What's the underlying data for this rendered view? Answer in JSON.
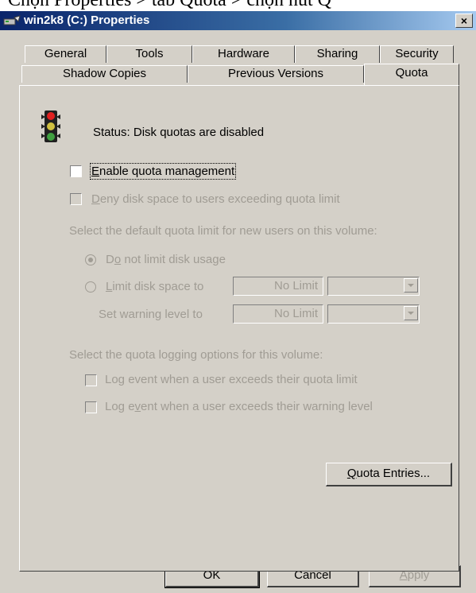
{
  "caption": "Chọn Properties > tab Quota > chọn nút Q",
  "window": {
    "title": "win2k8 (C:) Properties",
    "close_label": "×"
  },
  "tabs": {
    "row1": [
      "General",
      "Tools",
      "Hardware",
      "Sharing",
      "Security"
    ],
    "row2": [
      "Shadow Copies",
      "Previous Versions",
      "Quota"
    ],
    "active": "Quota"
  },
  "quota": {
    "status": "Status:  Disk quotas are disabled",
    "enable_quota": {
      "label_first": "E",
      "label_rest": "nable quota management",
      "checked": false
    },
    "deny_space": {
      "label_first": "D",
      "label_rest": "eny disk space to users exceeding quota limit",
      "checked": false
    },
    "default_limit_heading": "Select the default quota limit for new users on this volume:",
    "no_limit_radio": {
      "label_pre": "D",
      "label_u": "o",
      "label_rest": " not limit disk usage",
      "selected": true
    },
    "limit_radio": {
      "label_first": "L",
      "label_rest": "imit disk space to",
      "selected": false
    },
    "limit_value": "No Limit",
    "warning_label": "Set warning level to",
    "warning_value": "No Limit",
    "logging_heading": "Select the quota logging options for this volume:",
    "log_quota": {
      "label": "Log event when a user exceeds their quota limit",
      "checked": false
    },
    "log_warning": {
      "label_pre": "Log e",
      "label_u": "v",
      "label_rest": "ent when a user exceeds their warning level",
      "checked": false
    },
    "entries_button": {
      "label_first": "Q",
      "label_rest": "uota Entries..."
    }
  },
  "buttons": {
    "ok": "OK",
    "cancel": "Cancel",
    "apply_first": "A",
    "apply_rest": "pply"
  },
  "colors": {
    "face": "#d4d0c8",
    "disabled_text": "#a09c94",
    "title_gradient_start": "#0a246a",
    "title_gradient_end": "#a6caf0"
  },
  "icons": {
    "app": "drive-properties-icon",
    "status": "traffic-light-icon"
  }
}
